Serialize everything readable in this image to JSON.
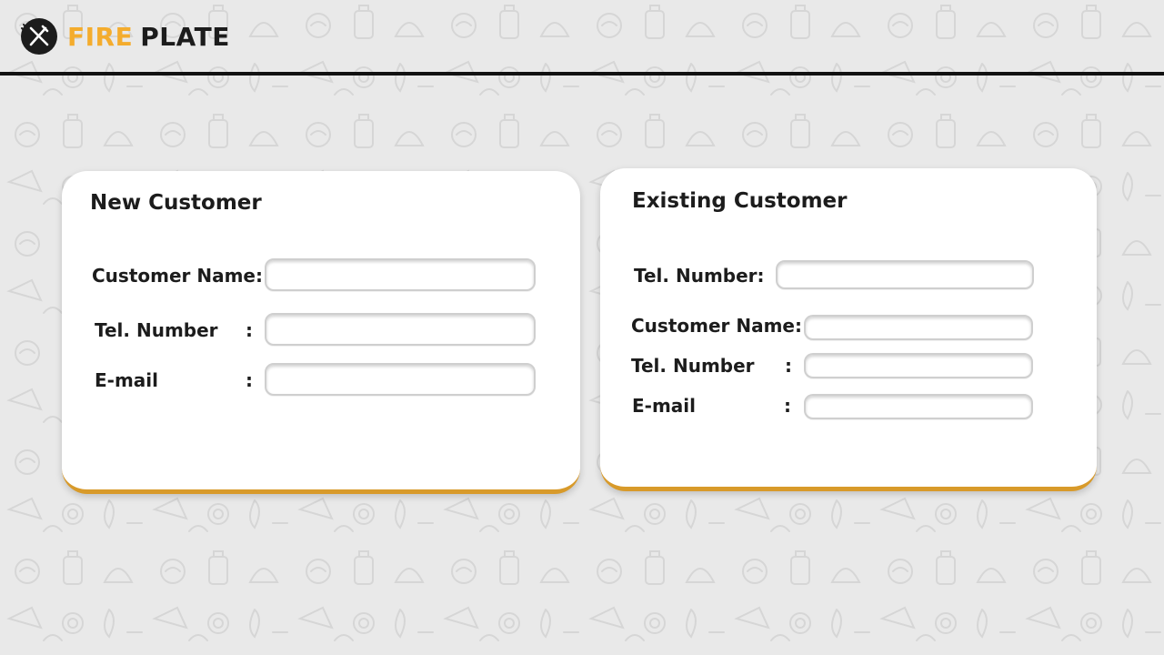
{
  "brand": {
    "word1": "FIRE",
    "word2": "PLATE",
    "logo_icon": "fork-and-knife-icon",
    "accent_color": "#f4ac2d"
  },
  "new_customer": {
    "title": "New Customer",
    "fields": [
      {
        "label": "Customer Name:",
        "colon": "",
        "value": "",
        "placeholder": ""
      },
      {
        "label": "Tel. Number",
        "colon": ":",
        "value": "",
        "placeholder": ""
      },
      {
        "label": "E-mail",
        "colon": ":",
        "value": "",
        "placeholder": ""
      }
    ]
  },
  "existing_customer": {
    "title": "Existing Customer",
    "lookup": {
      "label": "Tel. Number:",
      "value": "",
      "placeholder": ""
    },
    "fields": [
      {
        "label": "Customer Name:",
        "colon": "",
        "value": "",
        "placeholder": ""
      },
      {
        "label": "Tel. Number",
        "colon": ":",
        "value": "",
        "placeholder": ""
      },
      {
        "label": "E-mail",
        "colon": ":",
        "value": "",
        "placeholder": ""
      }
    ]
  },
  "theme": {
    "card_border_color": "#d89a2a",
    "background_color": "#e9e9e9"
  }
}
